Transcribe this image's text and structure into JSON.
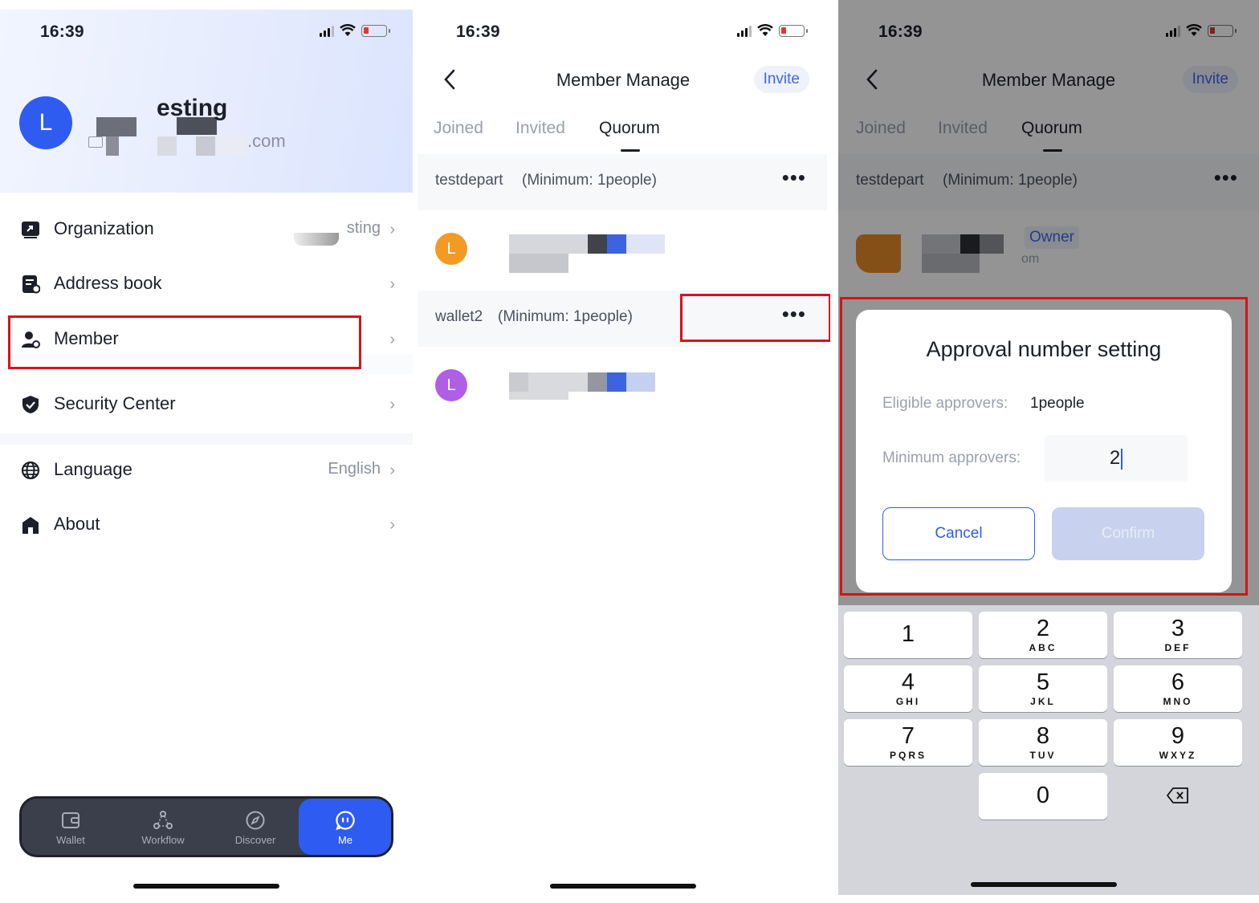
{
  "status_bar": {
    "time": "16:39"
  },
  "screen1": {
    "profile": {
      "avatar_letter": "L",
      "name": "esting",
      "email": ".com"
    },
    "menu": [
      {
        "label": "Organization",
        "value": "sting"
      },
      {
        "label": "Address book",
        "value": ""
      },
      {
        "label": "Member",
        "value": ""
      },
      {
        "label": "Security Center",
        "value": ""
      },
      {
        "label": "Language",
        "value": "English"
      },
      {
        "label": "About",
        "value": ""
      }
    ],
    "tabbar": [
      {
        "label": "Wallet",
        "icon": "wallet-icon"
      },
      {
        "label": "Workflow",
        "icon": "workflow-icon"
      },
      {
        "label": "Discover",
        "icon": "compass-icon"
      },
      {
        "label": "Me",
        "icon": "me-icon"
      }
    ]
  },
  "screen2": {
    "title": "Member Manage",
    "invite": "Invite",
    "tabs": [
      "Joined",
      "Invited",
      "Quorum"
    ],
    "groups": [
      {
        "name": "testdepart",
        "minimum": "(Minimum: 1people)",
        "member_avatar": "L",
        "color": "#f39a25"
      },
      {
        "name": "wallet2",
        "minimum": "(Minimum: 1people)",
        "member_avatar": "L",
        "color": "#b05ee6"
      }
    ]
  },
  "screen3": {
    "title": "Member Manage",
    "invite": "Invite",
    "tabs": [
      "Joined",
      "Invited",
      "Quorum"
    ],
    "group": {
      "name": "testdepart",
      "minimum": "(Minimum: 1people)"
    },
    "member_badge": "Owner",
    "member_email": "om",
    "dialog": {
      "title": "Approval number setting",
      "eligible_label": "Eligible approvers:",
      "eligible_value": "1people",
      "minimum_label": "Minimum approvers:",
      "minimum_value": "2",
      "cancel": "Cancel",
      "confirm": "Confirm"
    },
    "keypad": [
      {
        "digit": "1",
        "letters": ""
      },
      {
        "digit": "2",
        "letters": "ABC"
      },
      {
        "digit": "3",
        "letters": "DEF"
      },
      {
        "digit": "4",
        "letters": "GHI"
      },
      {
        "digit": "5",
        "letters": "JKL"
      },
      {
        "digit": "6",
        "letters": "MNO"
      },
      {
        "digit": "7",
        "letters": "PQRS"
      },
      {
        "digit": "8",
        "letters": "TUV"
      },
      {
        "digit": "9",
        "letters": "WXYZ"
      },
      {
        "digit": "0",
        "letters": ""
      }
    ]
  },
  "colors": {
    "accent": "#2e5cf2",
    "highlight": "#d6121a",
    "tabbar": "#3b3f4c"
  }
}
